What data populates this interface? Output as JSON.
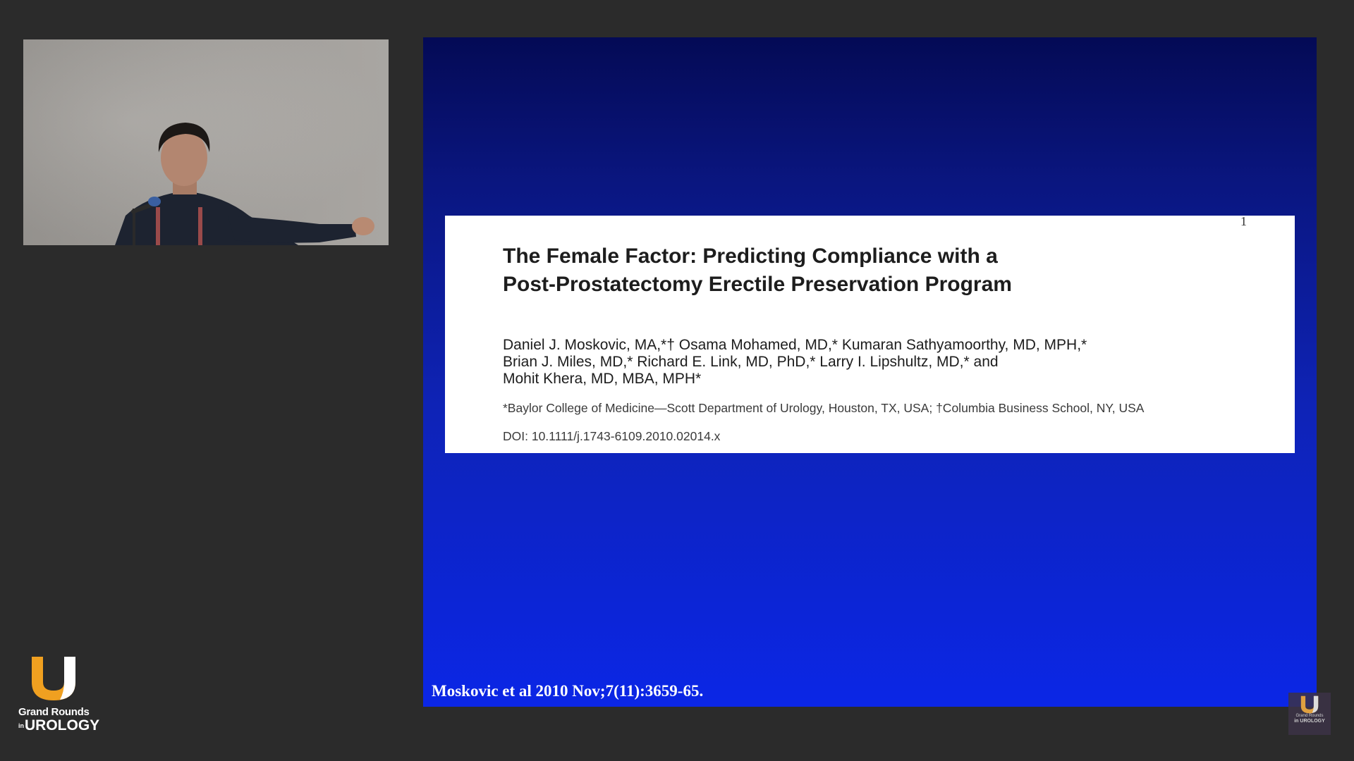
{
  "slide": {
    "paper": {
      "corner_mark": "1",
      "title_lines": [
        "The Female Factor: Predicting Compliance with a",
        "Post-Prostatectomy Erectile Preservation Program"
      ],
      "author_lines": [
        "Daniel J. Moskovic, MA,*† Osama Mohamed, MD,* Kumaran Sathyamoorthy, MD, MPH,*",
        "Brian J. Miles, MD,* Richard E. Link, MD, PhD,* Larry I. Lipshultz, MD,* and",
        "Mohit Khera, MD, MBA, MPH*"
      ],
      "affiliation": "*Baylor College of Medicine—Scott Department of Urology, Houston, TX, USA; †Columbia Business School, NY, USA",
      "doi": "DOI: 10.1111/j.1743-6109.2010.02014.x"
    },
    "citation": "Moskovic et al 2010 Nov;7(11):3659-65."
  },
  "brand": {
    "line1": "Grand Rounds",
    "line2_prefix": "in",
    "line2_main": "UROLOGY",
    "mark_color": "#f0a020"
  },
  "watermark": {
    "line1": "Grand Rounds",
    "line2": "in UROLOGY"
  },
  "colors": {
    "background": "#2b2b2b",
    "slide_top": "#040a55",
    "slide_bottom": "#0b26e6",
    "card": "#ffffff"
  }
}
